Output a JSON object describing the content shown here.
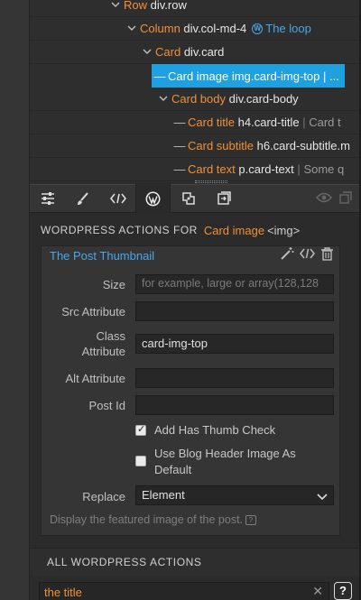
{
  "tree": {
    "rows": [
      {
        "kind": "Row",
        "tag": "div.row"
      },
      {
        "kind": "Column",
        "tag": "div.col-md-4",
        "extra": "The loop"
      },
      {
        "kind": "Card",
        "tag": "div.card"
      },
      {
        "kind": "Card image",
        "tag": "img.card-img-top",
        "sep": "|",
        "more": "..."
      },
      {
        "kind": "Card body",
        "tag": "div.card-body"
      },
      {
        "kind": "Card title",
        "tag": "h4.card-title",
        "sep": "|",
        "more": "Card t"
      },
      {
        "kind": "Card subtitle",
        "tag": "h6.card-subtitle.m"
      },
      {
        "kind": "Card text",
        "tag": "p.card-text",
        "sep": "|",
        "more": "Some q"
      }
    ]
  },
  "toolbar": {
    "icons": [
      "sliders-icon",
      "brush-icon",
      "code-icon",
      "wordpress-icon",
      "component-icon",
      "library-icon"
    ],
    "right_icons": [
      "eye-icon",
      "duplicate-icon"
    ]
  },
  "panel": {
    "header": "WORDPRESS ACTIONS FOR",
    "element_name": "Card image",
    "element_tag": "<img>"
  },
  "action": {
    "title": "The Post Thumbnail",
    "fields": {
      "size_label": "Size",
      "size_placeholder": "for example, large or array(128,128",
      "src_label": "Src Attribute",
      "class_label": "Class Attribute",
      "class_value": "card-img-top",
      "alt_label": "Alt Attribute",
      "postid_label": "Post Id",
      "thumbcheck_label": "Add Has Thumb Check",
      "blogheader_label": "Use Blog Header Image As Default",
      "replace_label": "Replace",
      "replace_value": "Element"
    },
    "description": "Display the featured image of the post."
  },
  "all_actions": {
    "header": "ALL WORDPRESS ACTIONS",
    "search_value": "the title",
    "help": "?"
  },
  "colors": {
    "accent_blue": "#1fa0e0",
    "orange": "#f0903a",
    "link_blue": "#4aa6e8"
  }
}
